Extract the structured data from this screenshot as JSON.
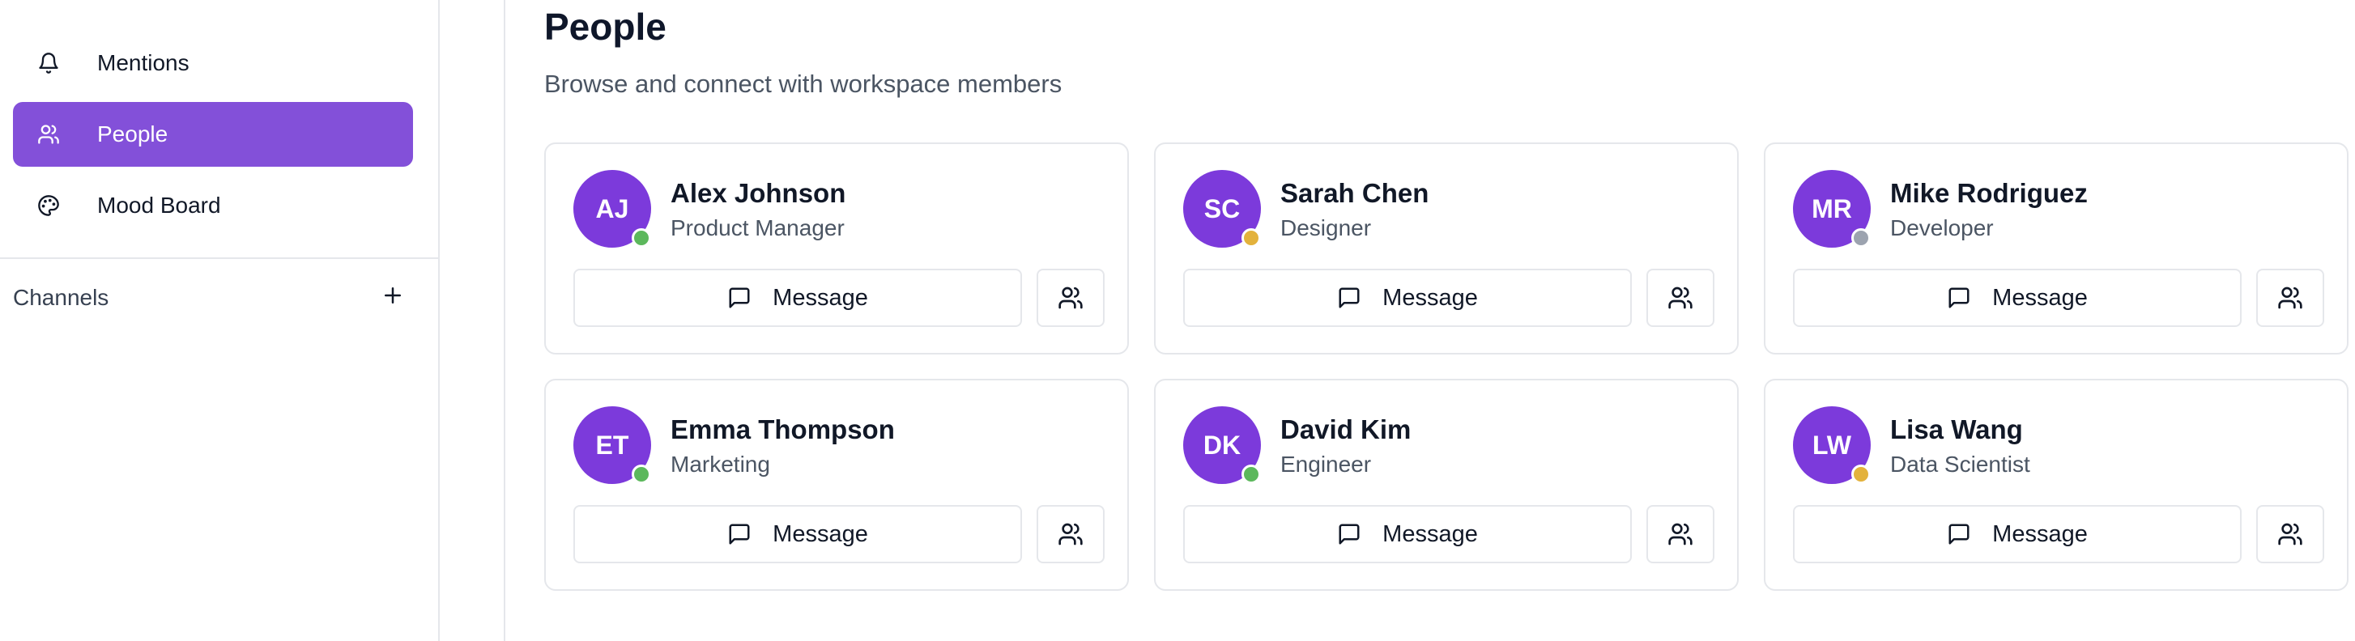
{
  "sidebar": {
    "items": [
      {
        "label": "Mentions",
        "icon": "bell-icon",
        "active": false
      },
      {
        "label": "People",
        "icon": "users-icon",
        "active": true
      },
      {
        "label": "Mood Board",
        "icon": "palette-icon",
        "active": false
      }
    ],
    "channels_label": "Channels"
  },
  "page": {
    "title": "People",
    "subtitle": "Browse and connect with workspace members"
  },
  "colors": {
    "accent": "#8350d9",
    "avatar": "#7c3adb",
    "online": "#5cb85c",
    "away": "#e3b23c",
    "offline": "#9ca3af"
  },
  "people": [
    {
      "initials": "AJ",
      "name": "Alex Johnson",
      "role": "Product Manager",
      "status": "online",
      "message_label": "Message"
    },
    {
      "initials": "SC",
      "name": "Sarah Chen",
      "role": "Designer",
      "status": "away",
      "message_label": "Message"
    },
    {
      "initials": "MR",
      "name": "Mike Rodriguez",
      "role": "Developer",
      "status": "offline",
      "message_label": "Message"
    },
    {
      "initials": "ET",
      "name": "Emma Thompson",
      "role": "Marketing",
      "status": "online",
      "message_label": "Message"
    },
    {
      "initials": "DK",
      "name": "David Kim",
      "role": "Engineer",
      "status": "online",
      "message_label": "Message"
    },
    {
      "initials": "LW",
      "name": "Lisa Wang",
      "role": "Data Scientist",
      "status": "away",
      "message_label": "Message"
    }
  ]
}
